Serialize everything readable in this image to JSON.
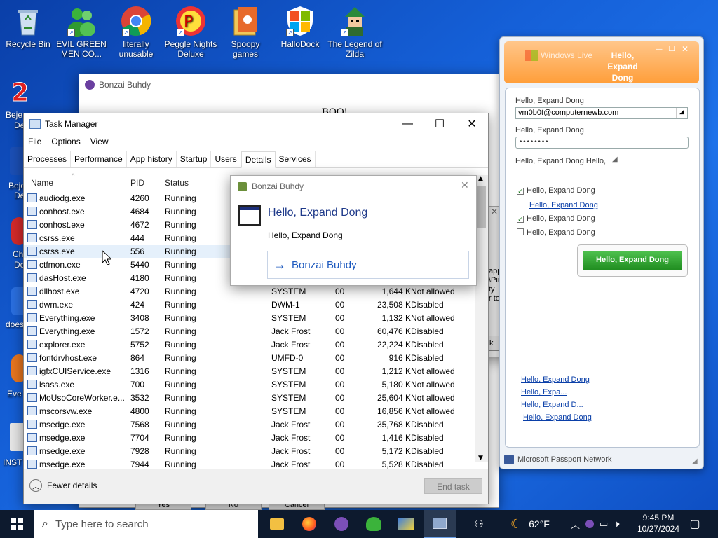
{
  "desktop_icons": [
    {
      "label": "Recycle Bin",
      "icon": "recycle-bin-icon"
    },
    {
      "label": "EVIL GREEN MEN CO...",
      "icon": "messenger-buddy-icon"
    },
    {
      "label": "literally unusable",
      "icon": "chrome-icon"
    },
    {
      "label": "Peggle Nights Deluxe",
      "icon": "peggle-icon"
    },
    {
      "label": "Spoopy games",
      "icon": "folder-icon"
    },
    {
      "label": "HalloDock",
      "icon": "windows-shield-icon"
    },
    {
      "label": "The Legend of Zilda",
      "icon": "zilda-icon"
    }
  ],
  "left_partial_labels": [
    "Beje",
    "De",
    "Beje",
    "De",
    "Ch",
    "De",
    "does",
    "Eve",
    "INST"
  ],
  "bonzai_back": {
    "title": "Bonzai Buhdy",
    "text": "BOO!"
  },
  "task_manager": {
    "title": "Task Manager",
    "menu": [
      "File",
      "Options",
      "View"
    ],
    "tabs": [
      "Processes",
      "Performance",
      "App history",
      "Startup",
      "Users",
      "Details",
      "Services"
    ],
    "active_tab": "Details",
    "columns": [
      "Name",
      "PID",
      "Status"
    ],
    "processes": [
      {
        "name": "audiodg.exe",
        "pid": "4260",
        "status": "Running",
        "user": "",
        "cpu": "",
        "mem": "",
        "uac": ""
      },
      {
        "name": "conhost.exe",
        "pid": "4684",
        "status": "Running",
        "user": "",
        "cpu": "",
        "mem": "",
        "uac": ""
      },
      {
        "name": "conhost.exe",
        "pid": "4672",
        "status": "Running",
        "user": "",
        "cpu": "",
        "mem": "",
        "uac": ""
      },
      {
        "name": "csrss.exe",
        "pid": "444",
        "status": "Running",
        "user": "",
        "cpu": "",
        "mem": "",
        "uac": ""
      },
      {
        "name": "csrss.exe",
        "pid": "556",
        "status": "Running",
        "user": "",
        "cpu": "",
        "mem": "",
        "uac": ""
      },
      {
        "name": "ctfmon.exe",
        "pid": "5440",
        "status": "Running",
        "user": "",
        "cpu": "",
        "mem": "",
        "uac": ""
      },
      {
        "name": "dasHost.exe",
        "pid": "4180",
        "status": "Running",
        "user": "",
        "cpu": "",
        "mem": "",
        "uac": ""
      },
      {
        "name": "dllhost.exe",
        "pid": "4720",
        "status": "Running",
        "user": "SYSTEM",
        "cpu": "00",
        "mem": "1,644 K",
        "uac": "Not allowed"
      },
      {
        "name": "dwm.exe",
        "pid": "424",
        "status": "Running",
        "user": "DWM-1",
        "cpu": "00",
        "mem": "23,508 K",
        "uac": "Disabled"
      },
      {
        "name": "Everything.exe",
        "pid": "3408",
        "status": "Running",
        "user": "SYSTEM",
        "cpu": "00",
        "mem": "1,132 K",
        "uac": "Not allowed"
      },
      {
        "name": "Everything.exe",
        "pid": "1572",
        "status": "Running",
        "user": "Jack Frost",
        "cpu": "00",
        "mem": "60,476 K",
        "uac": "Disabled"
      },
      {
        "name": "explorer.exe",
        "pid": "5752",
        "status": "Running",
        "user": "Jack Frost",
        "cpu": "00",
        "mem": "22,224 K",
        "uac": "Disabled"
      },
      {
        "name": "fontdrvhost.exe",
        "pid": "864",
        "status": "Running",
        "user": "UMFD-0",
        "cpu": "00",
        "mem": "916 K",
        "uac": "Disabled"
      },
      {
        "name": "igfxCUIService.exe",
        "pid": "1316",
        "status": "Running",
        "user": "SYSTEM",
        "cpu": "00",
        "mem": "1,212 K",
        "uac": "Not allowed"
      },
      {
        "name": "lsass.exe",
        "pid": "700",
        "status": "Running",
        "user": "SYSTEM",
        "cpu": "00",
        "mem": "5,180 K",
        "uac": "Not allowed"
      },
      {
        "name": "MoUsoCoreWorker.e...",
        "pid": "3532",
        "status": "Running",
        "user": "SYSTEM",
        "cpu": "00",
        "mem": "25,604 K",
        "uac": "Not allowed"
      },
      {
        "name": "mscorsvw.exe",
        "pid": "4800",
        "status": "Running",
        "user": "SYSTEM",
        "cpu": "00",
        "mem": "16,856 K",
        "uac": "Not allowed"
      },
      {
        "name": "msedge.exe",
        "pid": "7568",
        "status": "Running",
        "user": "Jack Frost",
        "cpu": "00",
        "mem": "35,768 K",
        "uac": "Disabled"
      },
      {
        "name": "msedge.exe",
        "pid": "7704",
        "status": "Running",
        "user": "Jack Frost",
        "cpu": "00",
        "mem": "1,416 K",
        "uac": "Disabled"
      },
      {
        "name": "msedge.exe",
        "pid": "7928",
        "status": "Running",
        "user": "Jack Frost",
        "cpu": "00",
        "mem": "5,172 K",
        "uac": "Disabled"
      },
      {
        "name": "msedge.exe",
        "pid": "7944",
        "status": "Running",
        "user": "Jack Frost",
        "cpu": "00",
        "mem": "5,528 K",
        "uac": "Disabled"
      }
    ],
    "fewer_details": "Fewer details",
    "end_task": "End task"
  },
  "bonzai_toast": {
    "title": "Bonzai Buhdy",
    "heading": "Hello, Expand Dong",
    "body": "Hello, Expand Dong",
    "link": "Bonzai Buhdy"
  },
  "partial_dialog": {
    "lines": [
      "app",
      "\\Pin",
      "ty",
      "r to"
    ],
    "button": "k"
  },
  "behind_buttons": [
    "Yes",
    "No",
    "Cancel"
  ],
  "messenger": {
    "brand": "Windows Live",
    "title": "Hello, Expand Dong",
    "email_label": "Hello, Expand Dong",
    "email_value": "vm0b0t@computernewb.com",
    "password_label": "Hello, Expand Dong",
    "password_value": "••••••••",
    "status_text": "Hello, Expand Dong  Hello,",
    "check1": "Hello, Expand Dong",
    "link1": "Hello, Expand Dong",
    "check2": "Hello, Expand Dong",
    "check3": "Hello, Expand Dong",
    "signin": "Hello, Expand Dong",
    "links": [
      "Hello, Expand Dong",
      "Hello, Expa...",
      "Hello, Expand D...",
      "Hello, Expand Dong"
    ],
    "footer": "Microsoft Passport Network"
  },
  "taskbar": {
    "search_placeholder": "Type here to search",
    "weather": "62°F",
    "time": "9:45 PM",
    "date": "10/27/2024"
  }
}
